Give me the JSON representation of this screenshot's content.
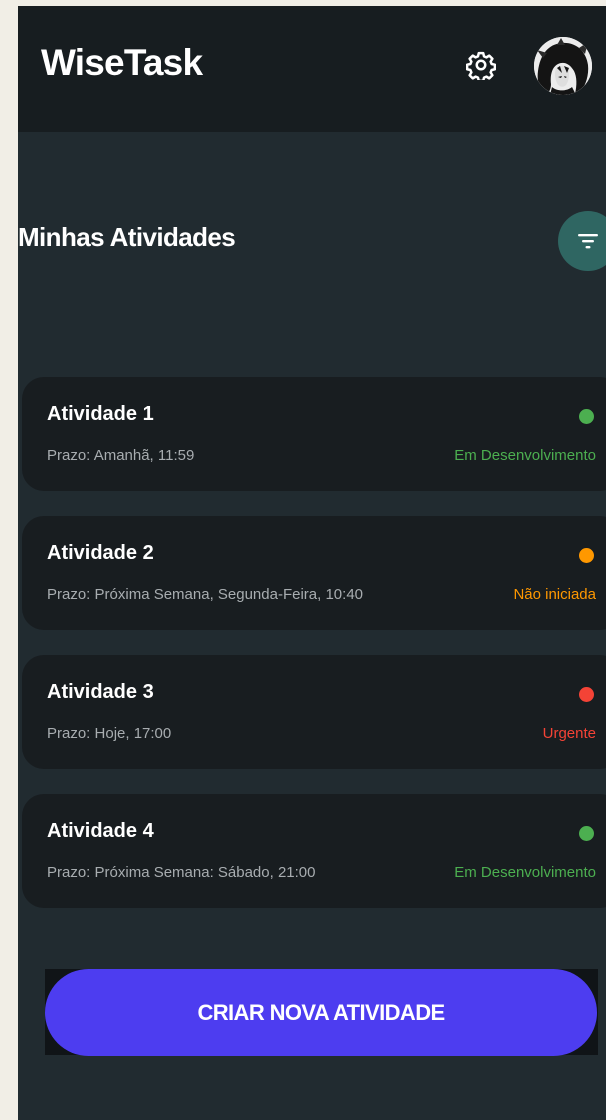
{
  "header": {
    "app_title": "WiseTask",
    "settings_icon": "gear-icon",
    "avatar_icon": "user-avatar"
  },
  "section": {
    "title": "Minhas Atividades",
    "filter_icon": "filter-icon",
    "filter_color": "#2f6662"
  },
  "tasks": [
    {
      "title": "Atividade 1",
      "deadline": "Prazo: Amanhã, 11:59",
      "status": "Em Desenvolvimento",
      "status_color": "#4caf50"
    },
    {
      "title": "Atividade 2",
      "deadline": "Prazo: Próxima Semana, Segunda-Feira, 10:40",
      "status": "Não iniciada",
      "status_color": "#ff9800"
    },
    {
      "title": "Atividade 3",
      "deadline": "Prazo: Hoje, 17:00",
      "status": "Urgente",
      "status_color": "#f44336"
    },
    {
      "title": "Atividade 4",
      "deadline": "Prazo: Próxima Semana: Sábado, 21:00",
      "status": "Em Desenvolvimento",
      "status_color": "#4caf50"
    }
  ],
  "actions": {
    "create_label": "CRIAR NOVA ATIVIDADE",
    "create_color": "#4d3df0"
  }
}
